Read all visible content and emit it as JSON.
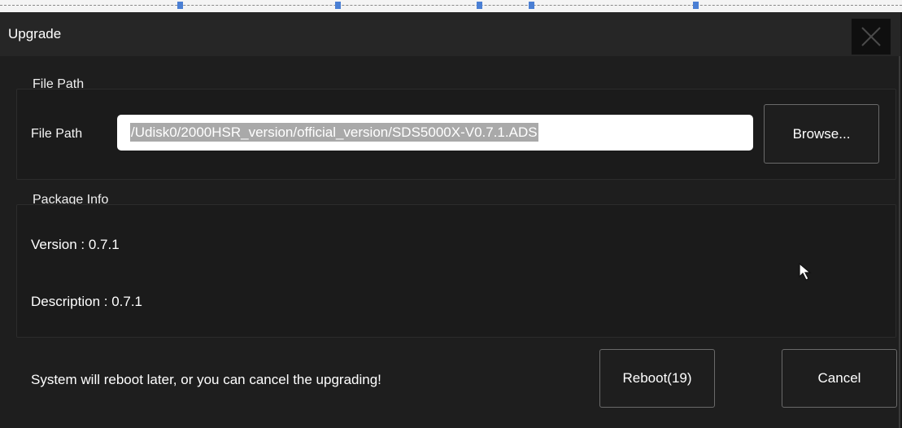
{
  "dialog": {
    "title": "Upgrade",
    "close_glyph": "✕"
  },
  "file_path_section": {
    "group_label": "File Path",
    "field_label": "File Path",
    "value": "/Udisk0/2000HSR_version/official_version/SDS5000X-V0.7.1.ADS",
    "browse_label": "Browse..."
  },
  "package_info": {
    "group_label": "Package Info",
    "version": "Version : 0.7.1",
    "description": "Description : 0.7.1"
  },
  "footer": {
    "message": "System will reboot later, or you can cancel the upgrading!",
    "reboot_label": "Reboot(19)",
    "cancel_label": "Cancel"
  },
  "icons": {
    "close": "close-icon",
    "pointer": "mouse-pointer-icon"
  },
  "colors": {
    "dialog_bg": "#1e1e1e",
    "titlebar_bg": "#262626",
    "button_border": "#6a6a6a",
    "selection": "#a9a9a9"
  }
}
